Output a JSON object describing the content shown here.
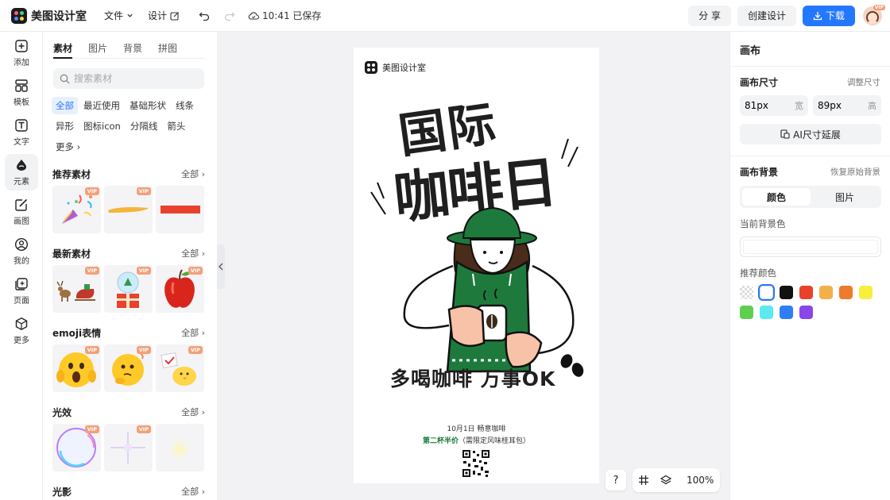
{
  "app": {
    "name": "美图设计室"
  },
  "topbar": {
    "file_menu": "文件",
    "design_menu": "设计",
    "save_status": "10:41 已保存",
    "share_label": "分 享",
    "create_label": "创建设计",
    "download_label": "下载",
    "vip_badge": "VIP"
  },
  "rail": {
    "items": [
      {
        "label": "添加",
        "icon": "plus-square-icon"
      },
      {
        "label": "模板",
        "icon": "template-icon"
      },
      {
        "label": "文字",
        "icon": "text-icon"
      },
      {
        "label": "元素",
        "icon": "shapes-icon"
      },
      {
        "label": "画图",
        "icon": "draw-icon"
      },
      {
        "label": "我的",
        "icon": "user-icon"
      },
      {
        "label": "页面",
        "icon": "page-add-icon"
      },
      {
        "label": "更多",
        "icon": "cube-icon"
      }
    ]
  },
  "panel": {
    "tabs": [
      "素材",
      "图片",
      "背景",
      "拼图"
    ],
    "search_placeholder": "搜索素材",
    "chips": [
      "全部",
      "最近使用",
      "基础形状",
      "线条",
      "异形",
      "图标icon",
      "分隔线",
      "箭头",
      "更多 ›"
    ],
    "sections": [
      {
        "title": "推荐素材",
        "more": "全部 ›"
      },
      {
        "title": "最新素材",
        "more": "全部 ›"
      },
      {
        "title": "emoji表情",
        "more": "全部 ›"
      },
      {
        "title": "光效",
        "more": "全部 ›"
      },
      {
        "title": "光影",
        "more": "全部 ›"
      }
    ],
    "vip_label": "VIP"
  },
  "poster": {
    "logo_text": "美图设计室",
    "title_line1": "国际",
    "title_line2": "咖啡日",
    "slogan": "多喝咖啡 万事OK",
    "date_line": "10月1日 畅意咖啡",
    "promo_highlight": "第二杯半价",
    "promo_rest": "（需限定风味桂耳包）",
    "brand_green": "#1e7a3c"
  },
  "canvas_tools": {
    "help": "?",
    "zoom": "100%"
  },
  "right_panel": {
    "title": "画布",
    "size_label": "画布尺寸",
    "size_action": "调整尺寸",
    "width_value": "81px",
    "width_unit": "宽",
    "height_value": "89px",
    "height_unit": "高",
    "ai_button": "AI尺寸延展",
    "bg_label": "画布背景",
    "bg_action": "恢复原始背景",
    "seg_color": "颜色",
    "seg_image": "图片",
    "current_bg": "当前背景色",
    "recommend": "推荐颜色",
    "colors": [
      "transparent",
      "#ffffff",
      "#111111",
      "#e8412c",
      "#f3b04a",
      "#ee7a2c",
      "#f7ee3d",
      "#5fcf4f",
      "#5de9f0",
      "#2f7ef5",
      "#8847e8"
    ]
  }
}
